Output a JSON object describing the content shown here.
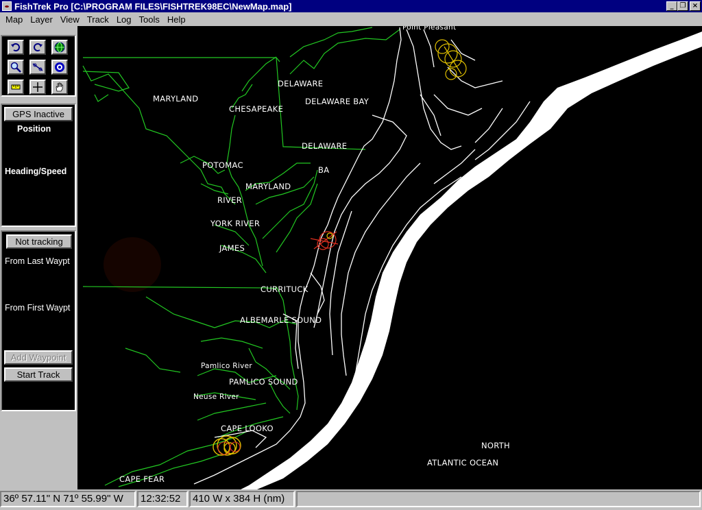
{
  "window": {
    "title": "FishTrek Pro [C:\\PROGRAM FILES\\FISHTREK98EC\\NewMap.map]",
    "controls": {
      "minimize": "_",
      "restore": "❐",
      "close": "×"
    }
  },
  "menu": [
    {
      "label": "Map"
    },
    {
      "label": "Layer"
    },
    {
      "label": "View"
    },
    {
      "label": "Track"
    },
    {
      "label": "Log"
    },
    {
      "label": "Tools"
    },
    {
      "label": "Help"
    }
  ],
  "toolbar": {
    "tools": [
      {
        "name": "undo-icon"
      },
      {
        "name": "redo-icon"
      },
      {
        "name": "globe-icon"
      },
      {
        "name": "zoom-icon"
      },
      {
        "name": "measure-icon"
      },
      {
        "name": "target-icon"
      },
      {
        "name": "ruler-icon"
      },
      {
        "name": "crosshair-icon"
      },
      {
        "name": "pan-hand-icon"
      }
    ]
  },
  "gps": {
    "button": "GPS Inactive",
    "position_label": "Position",
    "heading_label": "Heading/Speed"
  },
  "tracking": {
    "button": "Not tracking",
    "from_last": "From Last Waypt",
    "from_first": "From First Waypt",
    "add_waypoint": "Add Waypoint",
    "start_track": "Start Track"
  },
  "map_labels": {
    "point_pleasant": "Point Pleasant",
    "maryland_1": "MARYLAND",
    "delaware_1": "DELAWARE",
    "chesapeake": "CHESAPEAKE",
    "delaware_bay": "DELAWARE BAY",
    "delaware_2": "DELAWARE",
    "potomac": "POTOMAC",
    "ba": "BA",
    "maryland_2": "MARYLAND",
    "river": "RIVER",
    "york_river": "YORK RIVER",
    "james": "JAMES",
    "currituck": "CURRITUCK",
    "albemarle_sound": "ALBEMARLE SOUND",
    "pamlico_river": "Pamlico River",
    "pamlico_sound": "PAMLICO SOUND",
    "neuse_river": "Neuse River",
    "cape_lookout": "CAPE LOOKO",
    "cape_fear": "CAPE FEAR",
    "north": "NORTH",
    "atlantic_ocean": "ATLANTIC OCEAN"
  },
  "colors": {
    "borders": "#22c822",
    "coast": "#ffffff",
    "markers": "#e0c000",
    "markers_red": "#e03020"
  },
  "status": {
    "coordinates": "36º 57.11\" N 71º 55.99\" W",
    "time": "12:32:52",
    "extent": "410 W x 384 H (nm)"
  }
}
